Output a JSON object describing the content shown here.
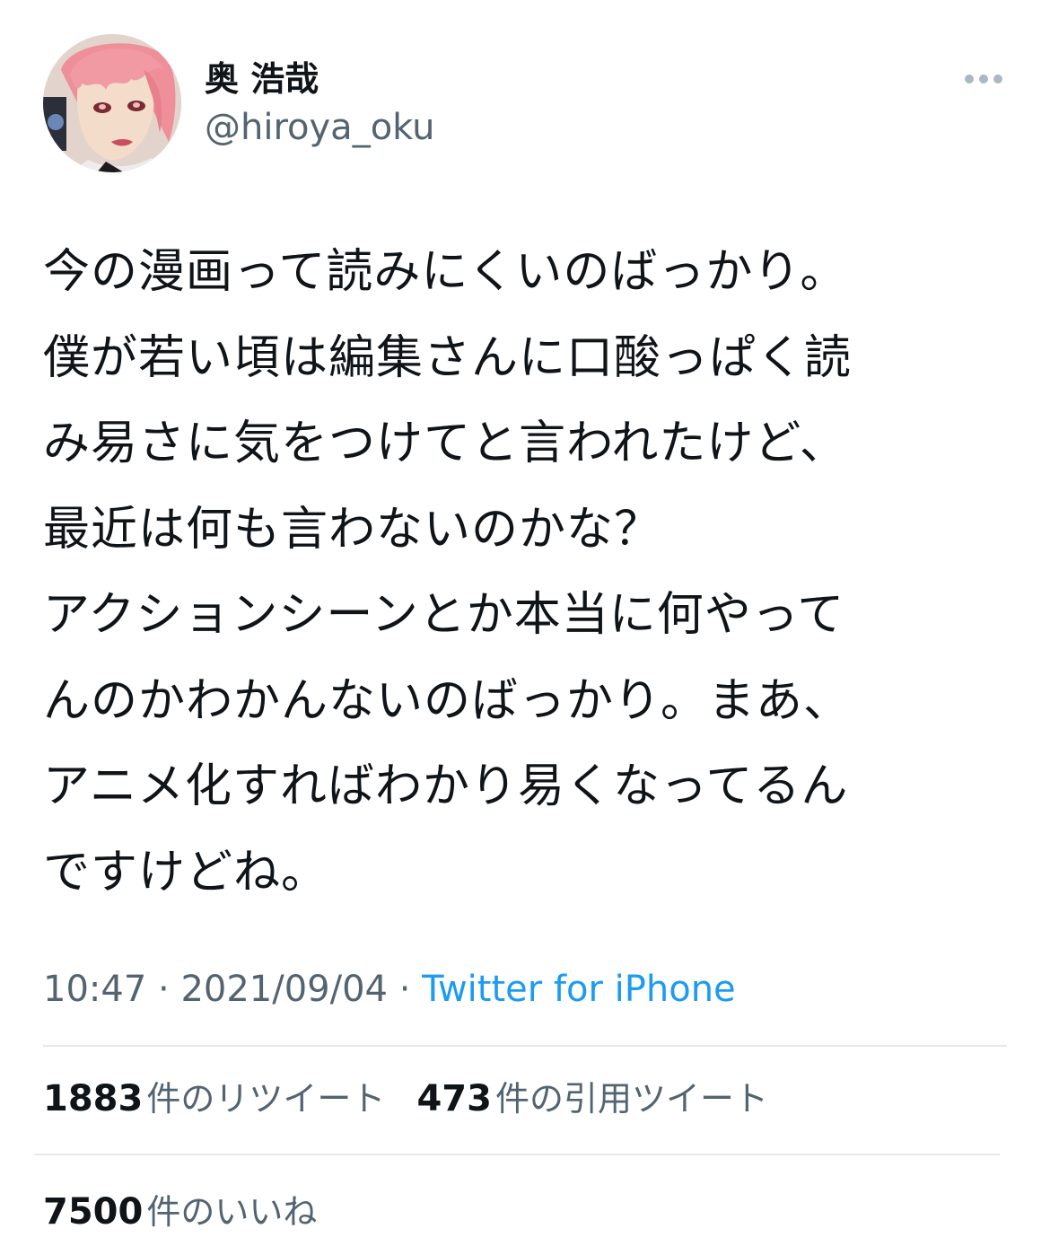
{
  "author": {
    "display_name": "奥 浩哉",
    "handle": "@hiroya_oku",
    "avatar_icon": "avatar-portrait-pink-hair"
  },
  "menu": {
    "icon": "more-horizontal-icon"
  },
  "tweet": {
    "lines": [
      "今の漫画って読みにくいのばっかり。",
      "僕が若い頃は編集さんに口酸っぱく読",
      "み易さに気をつけてと言われたけど、",
      "最近は何も言わないのかな？",
      "アクションシーンとか本当に何やって",
      "んのかわかんないのばっかり。まあ、",
      "アニメ化すればわかり易くなってるん",
      "ですけどね。"
    ]
  },
  "meta": {
    "time": "10:47",
    "sep1": " · ",
    "date": "2021/09/04",
    "sep2": " · ",
    "source": "Twitter for iPhone"
  },
  "stats": {
    "retweets": {
      "count": "1883",
      "label": "件のリツイート"
    },
    "quotes": {
      "count": "473",
      "label": "件の引用ツイート"
    },
    "likes": {
      "count": "7500",
      "label": "件のいいね"
    }
  },
  "colors": {
    "text": "#0f1419",
    "secondary": "#536471",
    "link": "#1d9bf0",
    "divider": "#e6e9eb"
  }
}
